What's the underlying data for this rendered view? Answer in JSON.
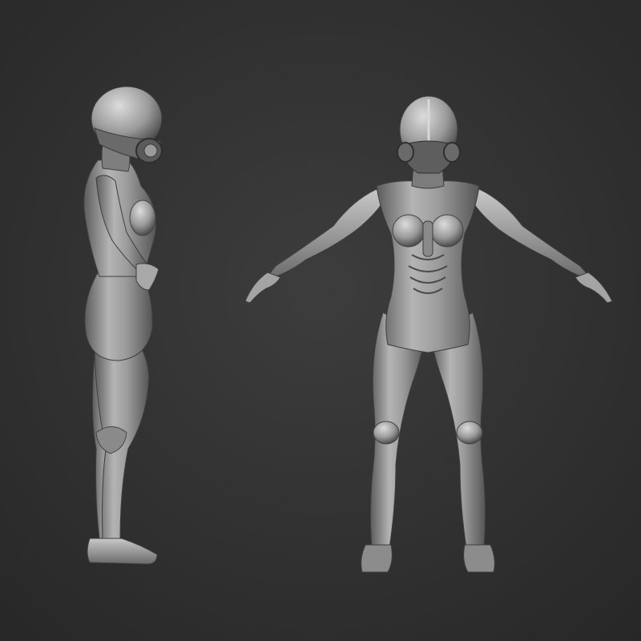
{
  "scene": {
    "background_center": "#3d3d3d",
    "background_edge": "#272727",
    "clay_light": "#c2c2c2",
    "clay_mid": "#8f8f8f",
    "clay_dark": "#3a3a3a"
  },
  "figures": [
    {
      "view": "side",
      "icon": "sculpt-figure-side-view"
    },
    {
      "view": "front",
      "icon": "sculpt-figure-front-view"
    }
  ]
}
